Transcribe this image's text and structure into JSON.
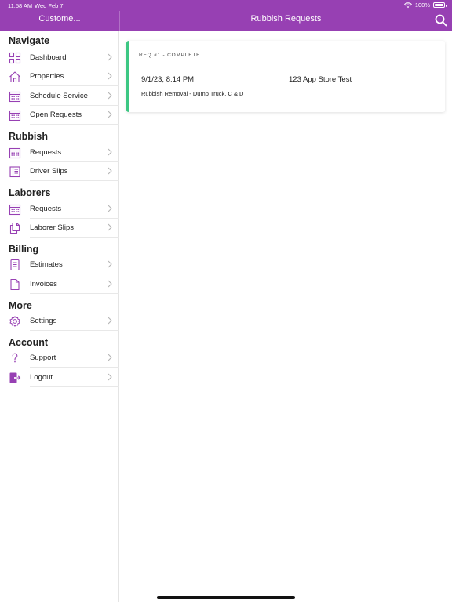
{
  "status_bar": {
    "time": "11:58 AM",
    "date": "Wed Feb 7",
    "battery": "100%",
    "battery_level": 1.0,
    "wifi_icon": "wifi-icon",
    "battery_icon": "battery-icon"
  },
  "nav": {
    "sidebar_title": "Custome...",
    "page_title": "Rubbish Requests",
    "search_icon": "search-icon"
  },
  "colors": {
    "accent": "#9740b3",
    "status_complete": "#3cc783"
  },
  "sidebar": {
    "sections": [
      {
        "title": "Navigate",
        "items": [
          {
            "label": "Dashboard",
            "icon": "dashboard-grid-icon"
          },
          {
            "label": "Properties",
            "icon": "house-icon"
          },
          {
            "label": "Schedule Service",
            "icon": "calendar-icon"
          },
          {
            "label": "Open Requests",
            "icon": "calendar-icon"
          }
        ]
      },
      {
        "title": "Rubbish",
        "items": [
          {
            "label": "Requests",
            "icon": "calendar-icon"
          },
          {
            "label": "Driver Slips",
            "icon": "clipboard-icon"
          }
        ]
      },
      {
        "title": "Laborers",
        "items": [
          {
            "label": "Requests",
            "icon": "calendar-icon"
          },
          {
            "label": "Laborer Slips",
            "icon": "copy-documents-icon"
          }
        ]
      },
      {
        "title": "Billing",
        "items": [
          {
            "label": "Estimates",
            "icon": "document-lines-icon"
          },
          {
            "label": "Invoices",
            "icon": "document-icon"
          }
        ]
      },
      {
        "title": "More",
        "items": [
          {
            "label": "Settings",
            "icon": "gear-icon"
          }
        ]
      },
      {
        "title": "Account",
        "items": [
          {
            "label": "Support",
            "icon": "question-mark-icon"
          },
          {
            "label": "Logout",
            "icon": "logout-icon"
          }
        ]
      }
    ]
  },
  "requests": [
    {
      "title": "REQ #1 - COMPLETE",
      "date": "9/1/23, 8:14 PM",
      "address": "123 App Store Test",
      "description": "Rubbish Removal - Dump Truck, C & D"
    }
  ]
}
